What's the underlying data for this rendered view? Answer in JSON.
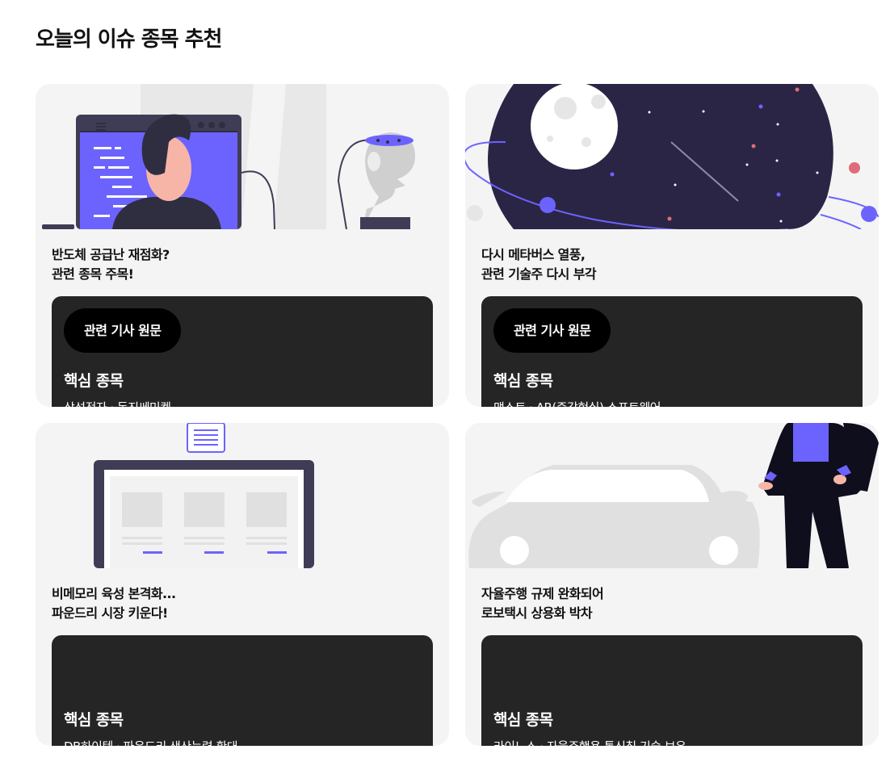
{
  "page": {
    "title": "오늘의 이슈 종목 추천"
  },
  "cards": [
    {
      "headline_1": "반도체 공급난 재점화?",
      "headline_2": "관련 종목 주목!",
      "button_label": "관련 기사 원문",
      "section_title": "핵심 종목",
      "stocks": "삼성전자 · 동진쎄미켐"
    },
    {
      "headline_1": "다시 메타버스 열풍,",
      "headline_2": "관련 기술주 다시 부각",
      "button_label": "관련 기사 원문",
      "section_title": "핵심 종목",
      "stocks": "맥스트 · AR(증강현실) 소프트웨어"
    },
    {
      "headline_1": "비메모리 육성 본격화...",
      "headline_2": "파운드리 시장 키운다!",
      "section_title": "핵심 종목",
      "stocks": "DB하이텍 · 파운드리 생산능력 확대"
    },
    {
      "headline_1": "자율주행 규제 완화되어",
      "headline_2": "로보택시 상용화 박차",
      "section_title": "핵심 종목",
      "stocks": "라이노스 · 자율주행용 통신칩 기술 보유"
    }
  ]
}
